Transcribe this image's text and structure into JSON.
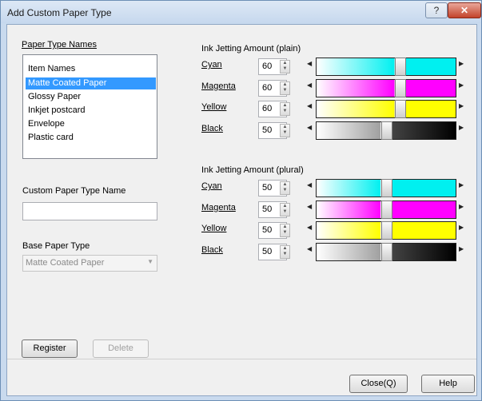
{
  "window": {
    "title": "Add Custom Paper Type",
    "help_label": "?",
    "close_label": "✕"
  },
  "left": {
    "paper_type_names_label": "Paper Type Names",
    "list_header": "Item Names",
    "items": [
      "Matte Coated Paper",
      "Glossy Paper",
      "Inkjet postcard",
      "Envelope",
      "Plastic card"
    ],
    "selected_index": 0,
    "custom_name_label": "Custom Paper Type Name",
    "custom_name_value": "",
    "base_type_label": "Base Paper Type",
    "base_type_value": "Matte Coated Paper"
  },
  "plain": {
    "label": "Ink Jetting Amount (plain)",
    "rows": [
      {
        "name": "Cyan",
        "value": "60",
        "level": 0.6,
        "color": "#00f0f0"
      },
      {
        "name": "Magenta",
        "value": "60",
        "level": 0.6,
        "color": "#ff00ff"
      },
      {
        "name": "Yellow",
        "value": "60",
        "level": 0.6,
        "color": "#ffff00"
      },
      {
        "name": "Black",
        "value": "50",
        "level": 0.5,
        "color": "#000000"
      }
    ]
  },
  "plural": {
    "label": "Ink Jetting Amount (plural)",
    "rows": [
      {
        "name": "Cyan",
        "value": "50",
        "level": 0.5,
        "color": "#00f0f0"
      },
      {
        "name": "Magenta",
        "value": "50",
        "level": 0.5,
        "color": "#ff00ff"
      },
      {
        "name": "Yellow",
        "value": "50",
        "level": 0.5,
        "color": "#ffff00"
      },
      {
        "name": "Black",
        "value": "50",
        "level": 0.5,
        "color": "#000000"
      }
    ]
  },
  "buttons": {
    "register": "Register",
    "delete": "Delete",
    "close": "Close(Q)",
    "help": "Help"
  }
}
